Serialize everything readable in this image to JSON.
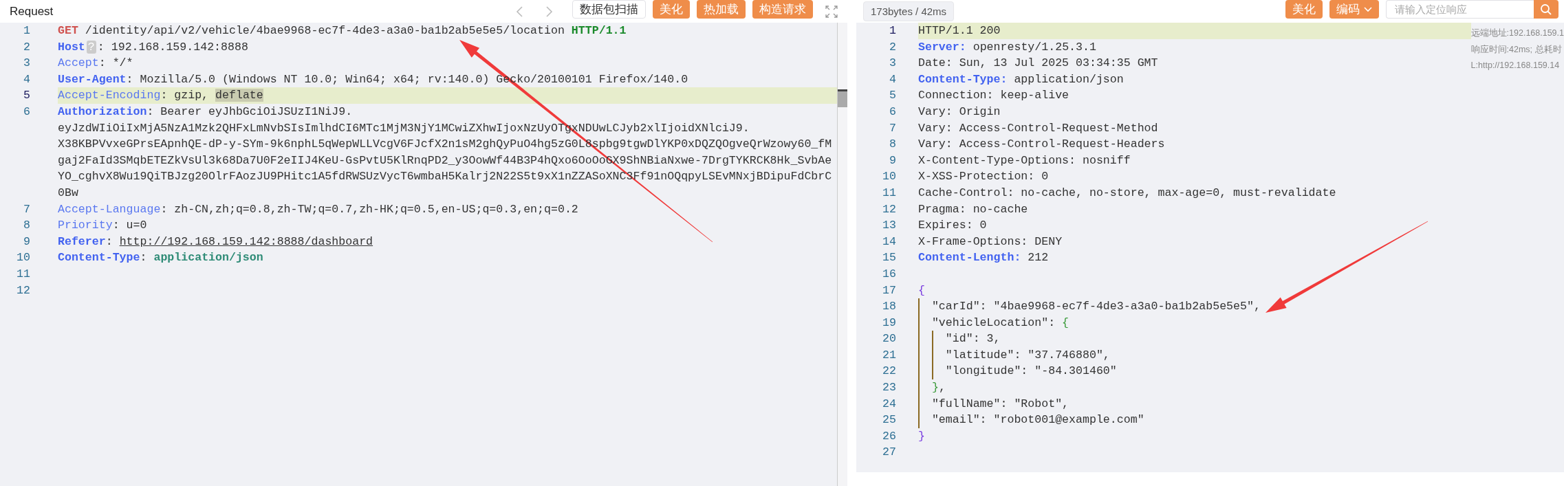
{
  "request": {
    "title": "Request",
    "buttons": [
      {
        "label": "数据包扫描",
        "kind": "outline"
      },
      {
        "label": "美化",
        "kind": "primary"
      },
      {
        "label": "热加载",
        "kind": "primary"
      },
      {
        "label": "构造请求",
        "kind": "primary"
      }
    ],
    "lines": [
      {
        "number": "1",
        "current": false,
        "segments": [
          {
            "kind": "method",
            "text": "GET"
          },
          {
            "kind": "text",
            "text": " /identity/api/v2/vehicle/4bae9968-ec7f-4de3-a3a0-ba1b2ab5e5e5/location "
          },
          {
            "kind": "version",
            "text": "HTTP/1.1"
          }
        ]
      },
      {
        "number": "2",
        "current": false,
        "segments": [
          {
            "kind": "key-bold",
            "text": "Host"
          },
          {
            "kind": "badge",
            "text": "?"
          },
          {
            "kind": "text",
            "text": ": 192.168.159.142:8888"
          }
        ]
      },
      {
        "number": "3",
        "current": false,
        "segments": [
          {
            "kind": "key",
            "text": "Accept"
          },
          {
            "kind": "text",
            "text": ": */*"
          }
        ]
      },
      {
        "number": "4",
        "current": false,
        "segments": [
          {
            "kind": "key-bold",
            "text": "User-Agent"
          },
          {
            "kind": "text",
            "text": ": Mozilla/5.0 (Windows NT 10.0; Win64; x64; rv:140.0) Gecko/20100101 Firefox/140.0"
          }
        ]
      },
      {
        "number": "5",
        "current": true,
        "segments": [
          {
            "kind": "key",
            "text": "Accept-Encoding"
          },
          {
            "kind": "text",
            "text": ": gzip, "
          },
          {
            "kind": "mark",
            "text": "deflate"
          }
        ]
      },
      {
        "number": "6",
        "current": false,
        "segments": [
          {
            "kind": "key-bold",
            "text": "Authorization"
          },
          {
            "kind": "text",
            "text": ": Bearer eyJhbGciOiJSUzI1NiJ9."
          }
        ],
        "continuation": [
          "eyJzdWIiOiIxMjA5NzA1Mzk2QHFxLmNvbSIsImlhdCI6MTc1MjM3NjY1MCwiZXhwIjoxNzUyOTgxNDUwLCJyb2xlIjoidXNlciJ9.",
          "X38KBPVvxeGPrsEApnhQE-dP-y-SYm-9k6nphL5qWepWLLVcgV6FJcfX2n1sM2ghQyPuO4hg5zG0L8spbg9tgwDlYKP0xDQZQOgveQrWzowy60_fM",
          "gaj2FaId3SMqbETEZkVsUl3k68Da7U0F2eIIJ4KeU-GsPvtU5KlRnqPD2_y3OowWf44B3P4hQxo6OoOoGX9ShNBiaNxwe-7DrgTYKRCK8Hk_SvbAe",
          "YO_cghvX8Wu19QiTBJzg20OlrFAozJU9PHitc1A5fdRWSUzVycT6wmbaH5Kalrj2N22S5t9xX1nZZASoXNC3Ff91nOQqpyLSEvMNxjBDipuFdCbrC",
          "0Bw"
        ]
      },
      {
        "number": "7",
        "current": false,
        "segments": [
          {
            "kind": "key",
            "text": "Accept-Language"
          },
          {
            "kind": "text",
            "text": ": zh-CN,zh;q=0.8,zh-TW;q=0.7,zh-HK;q=0.5,en-US;q=0.3,en;q=0.2"
          }
        ]
      },
      {
        "number": "8",
        "current": false,
        "segments": [
          {
            "kind": "key",
            "text": "Priority"
          },
          {
            "kind": "text",
            "text": ": u=0"
          }
        ]
      },
      {
        "number": "9",
        "current": false,
        "segments": [
          {
            "kind": "key-bold",
            "text": "Referer"
          },
          {
            "kind": "text",
            "text": ": "
          },
          {
            "kind": "url",
            "text": "http://192.168.159.142:8888/dashboard"
          }
        ]
      },
      {
        "number": "10",
        "current": false,
        "segments": [
          {
            "kind": "key-bold",
            "text": "Content-Type"
          },
          {
            "kind": "text",
            "text": ": "
          },
          {
            "kind": "value",
            "text": "application/json"
          }
        ]
      },
      {
        "number": "11",
        "current": false
      },
      {
        "number": "12",
        "current": false
      }
    ]
  },
  "response": {
    "stats": "173bytes / 42ms",
    "buttons": [
      {
        "label": "美化",
        "dropdown": false
      },
      {
        "label": "编码",
        "dropdown": true
      }
    ],
    "search": {
      "placeholder": "请输入定位响应"
    },
    "notes": [
      "远端地址:192.168.159.1",
      "响应时间:42ms; 总耗时",
      "L:http://192.168.159.14"
    ],
    "lines": [
      {
        "number": "1",
        "current": true,
        "segments": [
          {
            "kind": "text",
            "text": "HTTP/1.1 200"
          }
        ]
      },
      {
        "number": "2",
        "current": false,
        "segments": [
          {
            "kind": "key-bold",
            "text": "Server:"
          },
          {
            "kind": "text",
            "text": " openresty/1.25.3.1"
          }
        ]
      },
      {
        "number": "3",
        "current": false,
        "segments": [
          {
            "kind": "text",
            "text": "Date: Sun, 13 Jul 2025 03:34:35 GMT"
          }
        ]
      },
      {
        "number": "4",
        "current": false,
        "segments": [
          {
            "kind": "key-bold",
            "text": "Content-Type:"
          },
          {
            "kind": "text",
            "text": " application/json"
          }
        ]
      },
      {
        "number": "5",
        "current": false,
        "segments": [
          {
            "kind": "text",
            "text": "Connection: keep-alive"
          }
        ]
      },
      {
        "number": "6",
        "current": false,
        "segments": [
          {
            "kind": "text",
            "text": "Vary: Origin"
          }
        ]
      },
      {
        "number": "7",
        "current": false,
        "segments": [
          {
            "kind": "text",
            "text": "Vary: Access-Control-Request-Method"
          }
        ]
      },
      {
        "number": "8",
        "current": false,
        "segments": [
          {
            "kind": "text",
            "text": "Vary: Access-Control-Request-Headers"
          }
        ]
      },
      {
        "number": "9",
        "current": false,
        "segments": [
          {
            "kind": "text",
            "text": "X-Content-Type-Options: nosniff"
          }
        ]
      },
      {
        "number": "10",
        "current": false,
        "segments": [
          {
            "kind": "text",
            "text": "X-XSS-Protection: 0"
          }
        ]
      },
      {
        "number": "11",
        "current": false,
        "segments": [
          {
            "kind": "text",
            "text": "Cache-Control: no-cache, no-store, max-age=0, must-revalidate"
          }
        ]
      },
      {
        "number": "12",
        "current": false,
        "segments": [
          {
            "kind": "text",
            "text": "Pragma: no-cache"
          }
        ]
      },
      {
        "number": "13",
        "current": false,
        "segments": [
          {
            "kind": "text",
            "text": "Expires: 0"
          }
        ]
      },
      {
        "number": "14",
        "current": false,
        "segments": [
          {
            "kind": "text",
            "text": "X-Frame-Options: DENY"
          }
        ]
      },
      {
        "number": "15",
        "current": false,
        "segments": [
          {
            "kind": "key-bold",
            "text": "Content-Length:"
          },
          {
            "kind": "text",
            "text": " 212"
          }
        ]
      },
      {
        "number": "16",
        "current": false
      },
      {
        "number": "17",
        "current": false,
        "segments": [
          {
            "kind": "brace",
            "text": "{"
          }
        ]
      },
      {
        "number": "18",
        "current": false,
        "segments": [
          {
            "kind": "indent"
          },
          {
            "kind": "text",
            "text": "\"carId\": \"4bae9968-ec7f-4de3-a3a0-ba1b2ab5e5e5\","
          }
        ]
      },
      {
        "number": "19",
        "current": false,
        "segments": [
          {
            "kind": "indent"
          },
          {
            "kind": "text",
            "text": "\"vehicleLocation\": "
          },
          {
            "kind": "brace-nested",
            "text": "{"
          }
        ]
      },
      {
        "number": "20",
        "current": false,
        "segments": [
          {
            "kind": "indent"
          },
          {
            "kind": "indent"
          },
          {
            "kind": "text",
            "text": "\"id\": 3,"
          }
        ]
      },
      {
        "number": "21",
        "current": false,
        "segments": [
          {
            "kind": "indent"
          },
          {
            "kind": "indent"
          },
          {
            "kind": "text",
            "text": "\"latitude\": \"37.746880\","
          }
        ]
      },
      {
        "number": "22",
        "current": false,
        "segments": [
          {
            "kind": "indent"
          },
          {
            "kind": "indent"
          },
          {
            "kind": "text",
            "text": "\"longitude\": \"-84.301460\""
          }
        ]
      },
      {
        "number": "23",
        "current": false,
        "segments": [
          {
            "kind": "indent"
          },
          {
            "kind": "brace-nested",
            "text": "}"
          },
          {
            "kind": "text",
            "text": ","
          }
        ]
      },
      {
        "number": "24",
        "current": false,
        "segments": [
          {
            "kind": "indent"
          },
          {
            "kind": "text",
            "text": "\"fullName\": \"Robot\","
          }
        ]
      },
      {
        "number": "25",
        "current": false,
        "segments": [
          {
            "kind": "indent"
          },
          {
            "kind": "text",
            "text": "\"email\": \"robot001@example.com\""
          }
        ]
      },
      {
        "number": "26",
        "current": false,
        "segments": [
          {
            "kind": "brace",
            "text": "}"
          }
        ]
      },
      {
        "number": "27",
        "current": false
      }
    ]
  }
}
